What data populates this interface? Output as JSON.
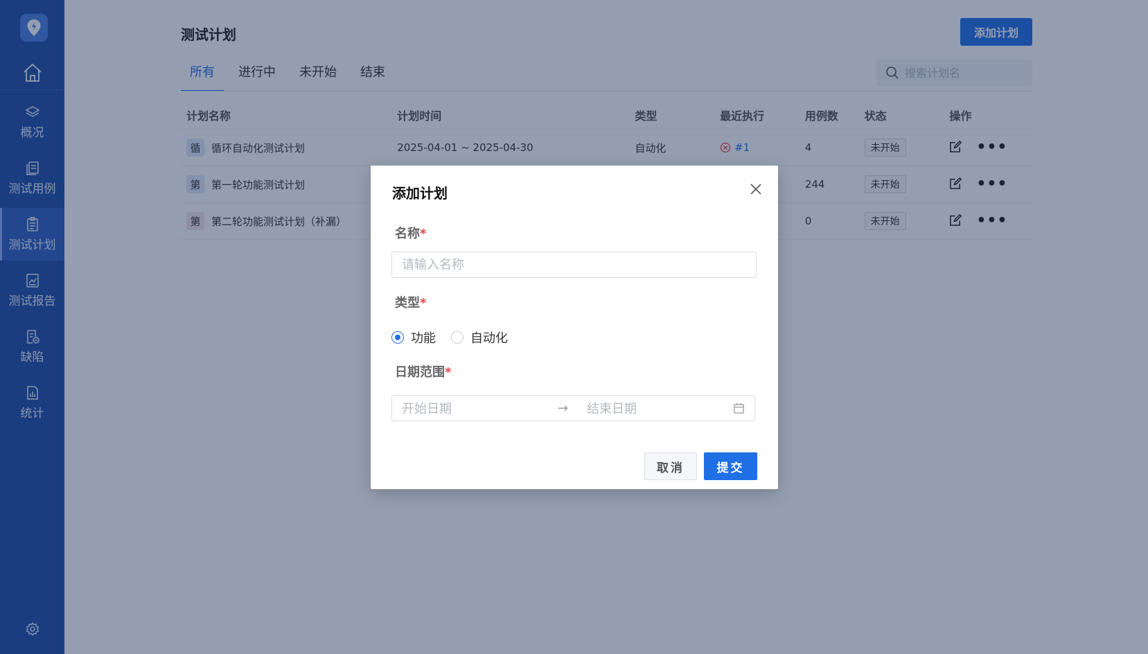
{
  "sidebar": {
    "items": [
      {
        "label": "概况",
        "icon": "layers-icon"
      },
      {
        "label": "测试用例",
        "icon": "cases-icon"
      },
      {
        "label": "测试计划",
        "icon": "clipboard-icon",
        "active": true
      },
      {
        "label": "测试报告",
        "icon": "chart-report-icon"
      },
      {
        "label": "缺陷",
        "icon": "bug-doc-icon"
      },
      {
        "label": "统计",
        "icon": "bar-chart-icon"
      }
    ]
  },
  "header": {
    "title": "测试计划",
    "add_button": "添加计划"
  },
  "tabs": [
    "所有",
    "进行中",
    "未开始",
    "结束"
  ],
  "search": {
    "placeholder": "搜索计划名"
  },
  "table": {
    "columns": [
      "计划名称",
      "计划时间",
      "类型",
      "最近执行",
      "用例数",
      "状态",
      "操作"
    ],
    "rows": [
      {
        "badge": "循",
        "name": "循环自动化测试计划",
        "time": "2025-04-01 ~ 2025-04-30",
        "type": "自动化",
        "exec": "#1",
        "cases": "4",
        "status": "未开始"
      },
      {
        "badge": "第",
        "name": "第一轮功能测试计划",
        "time": "",
        "type": "",
        "exec": "",
        "cases": "244",
        "status": "未开始"
      },
      {
        "badge": "第",
        "name": "第二轮功能测试计划（补漏）",
        "time": "",
        "type": "",
        "exec": "",
        "cases": "0",
        "status": "未开始"
      }
    ]
  },
  "modal": {
    "title": "添加计划",
    "name_label": "名称",
    "name_placeholder": "请输入名称",
    "type_label": "类型",
    "type_options": [
      "功能",
      "自动化"
    ],
    "type_selected": "功能",
    "date_label": "日期范围",
    "date_start_placeholder": "开始日期",
    "date_arrow": "→",
    "date_end_placeholder": "结束日期",
    "required_mark": "*",
    "cancel": "取消",
    "submit": "提交"
  },
  "colors": {
    "sidebar": "#1f4fa8",
    "primary": "#1f6fe5",
    "required": "#e54545",
    "error": "#e54545"
  }
}
